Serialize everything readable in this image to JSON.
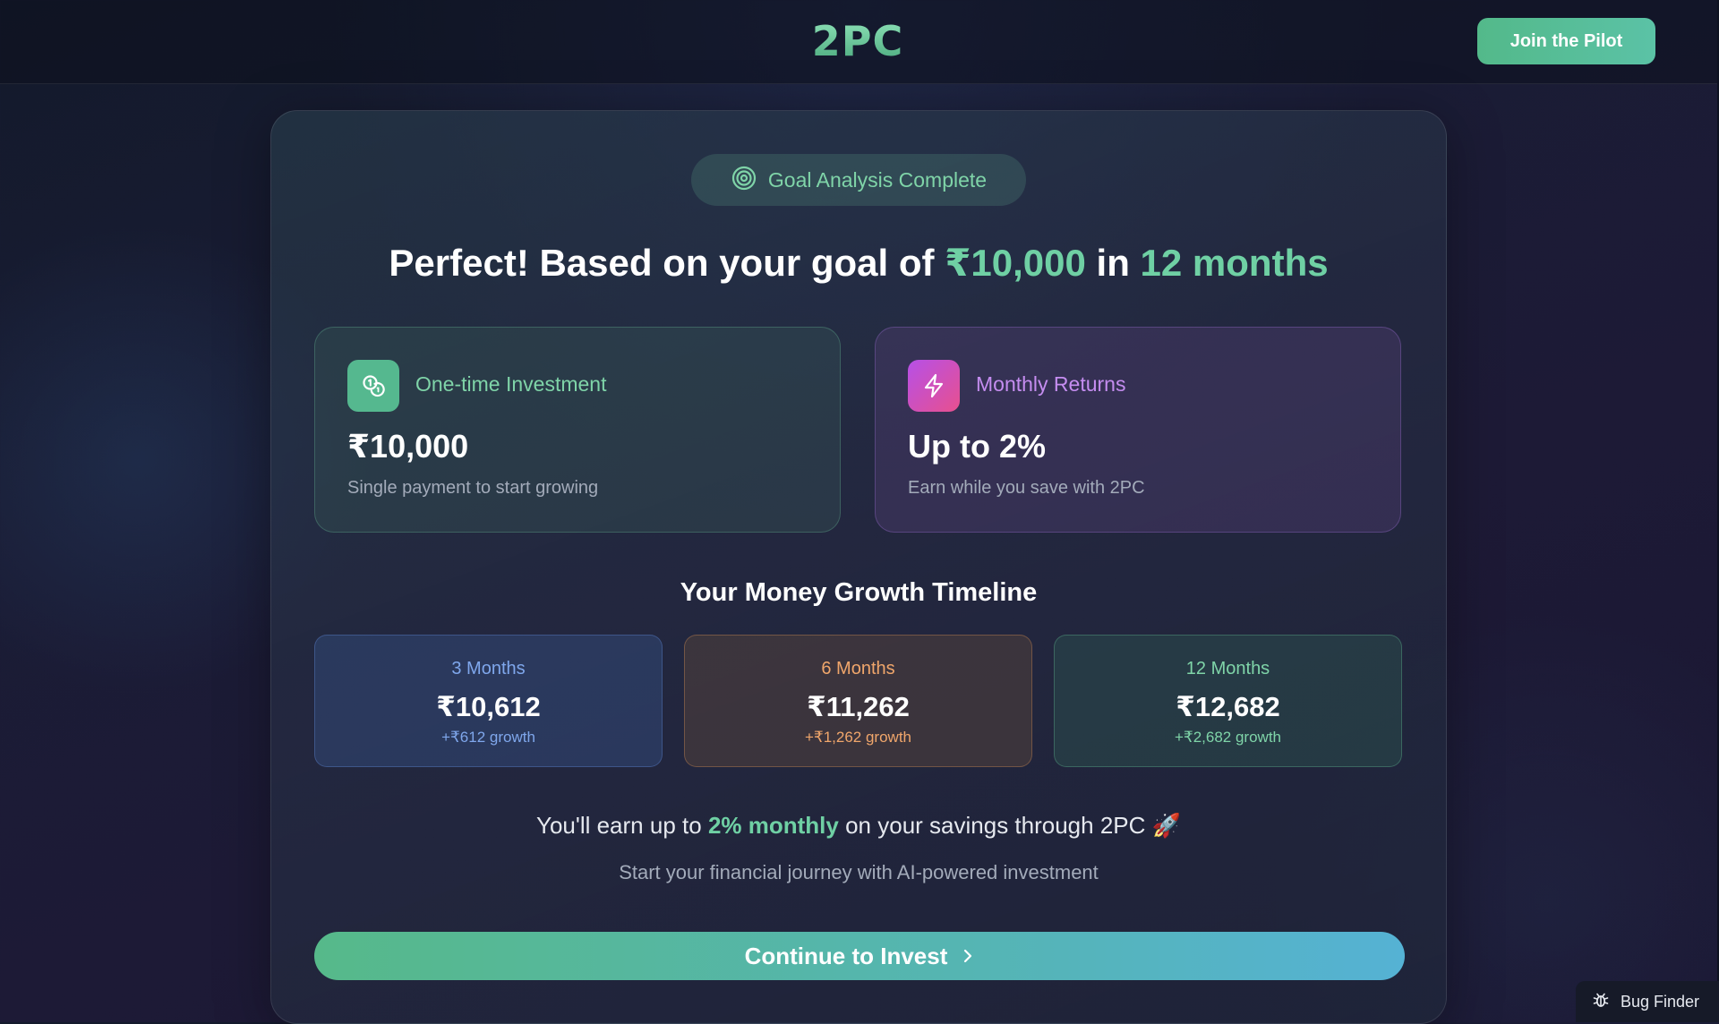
{
  "header": {
    "logo_text": "2PC",
    "join_button_label": "Join the Pilot"
  },
  "badge": {
    "text": "Goal Analysis Complete",
    "icon": "target-icon"
  },
  "headline": {
    "prefix": "Perfect! Based on your goal of",
    "amount": "₹10,000",
    "connector": "in",
    "duration": "12 months"
  },
  "cards": {
    "investment": {
      "icon": "coins-icon",
      "title": "One-time Investment",
      "value": "₹10,000",
      "subtitle": "Single payment to start growing"
    },
    "returns": {
      "icon": "lightning-icon",
      "title": "Monthly Returns",
      "value": "Up to 2%",
      "subtitle": "Earn while you save with 2PC"
    }
  },
  "timeline": {
    "title": "Your Money Growth Timeline",
    "items": [
      {
        "label": "3 Months",
        "value": "₹10,612",
        "growth": "+₹612 growth"
      },
      {
        "label": "6 Months",
        "value": "₹11,262",
        "growth": "+₹1,262 growth"
      },
      {
        "label": "12 Months",
        "value": "₹12,682",
        "growth": "+₹2,682 growth"
      }
    ]
  },
  "earn_line": {
    "prefix": "You'll earn up to",
    "highlight": "2% monthly",
    "suffix": "on your savings through 2PC",
    "emoji": "🚀"
  },
  "start_line": "Start your financial journey with AI-powered investment",
  "cta": {
    "label": "Continue to Invest",
    "icon": "chevron-right-icon"
  },
  "bug_finder": {
    "label": "Bug Finder",
    "icon": "bug-icon"
  },
  "colors": {
    "accent_green": "#6fd0a4",
    "accent_purple": "#c58df0",
    "accent_blue": "#7fa7ec",
    "accent_orange": "#f0a66b"
  }
}
